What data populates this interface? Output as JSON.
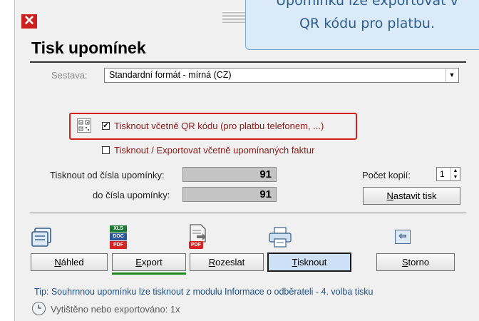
{
  "callout": {
    "line1": "Upomínku lze exportovat v",
    "line2": "QR kódu pro platbu."
  },
  "window": {
    "close_glyph": "✕",
    "title": "Tisk upomínek"
  },
  "sestava": {
    "label": "Sestava:",
    "value": "Standardní formát - mírná (CZ)"
  },
  "options": {
    "qr_label": "Tisknout včetně QR kódu (pro platbu telefonem, ...)",
    "qr_checked": "✔",
    "invoices_label": "Tisknout / Exportovat včetně upomínaných faktur"
  },
  "range": {
    "from_label": "Tisknout od čísla upomínky:",
    "from_value": "91",
    "to_label": "do čísla upomínky:",
    "to_value": "91"
  },
  "copies": {
    "label": "Počet kopií:",
    "value": "1"
  },
  "buttons": {
    "nastavit_first": "N",
    "nastavit_rest": "astavit tisk",
    "nahled_first": "N",
    "nahled_rest": "áhled",
    "export_first": "E",
    "export_rest": "xport",
    "rozeslat_first": "R",
    "rozeslat_rest": "ozeslat",
    "tisknout_first": "T",
    "tisknout_rest": "isknout",
    "storno_first": "S",
    "storno_rest": "torno"
  },
  "icons": {
    "xls": "XLS",
    "doc": "DOC",
    "pdf": "PDF",
    "pdf2": "PDF",
    "arrow": "⇦"
  },
  "footer": {
    "tip": "Tip: Souhrnnou upomínku lze tisknout z modulu Informace o odběrateli - 4. volba tisku",
    "status": "Vytištěno nebo exportováno: 1x"
  },
  "colors": {
    "accent_red": "#d42020",
    "tip_blue": "#1a4f8a",
    "active_button": "#cde0f5",
    "export_underline": "#1e8a1e"
  }
}
